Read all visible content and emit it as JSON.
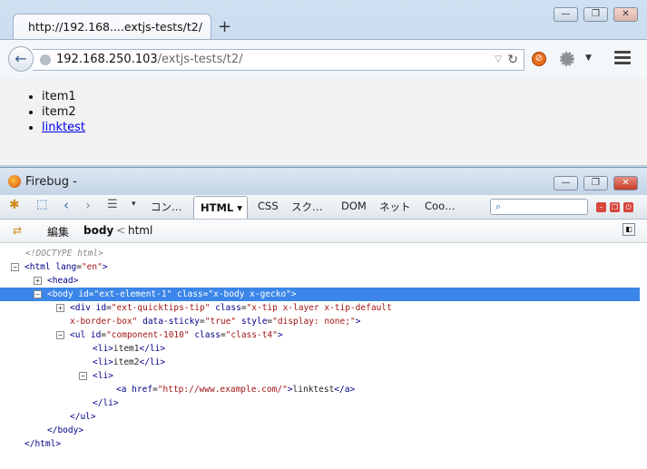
{
  "browser": {
    "tab_title": "http://192.168....extjs-tests/t2/",
    "new_tab": "+",
    "url_host": "192.168.250.103",
    "url_path": "/extjs-tests/t2/",
    "window_controls": {
      "minimize": "—",
      "maximize": "❐",
      "close": "✕"
    }
  },
  "page": {
    "items": [
      "item1",
      "item2"
    ],
    "link_text": "linktest"
  },
  "firebug": {
    "title": "Firebug -",
    "toolbar": {
      "console": "コン…",
      "html": "HTML ▾",
      "css": "CSS",
      "script": "スク…",
      "dom": "DOM",
      "net": "ネット",
      "cookies": "Coo…"
    },
    "breadcrumb": {
      "edit": "編集",
      "body": "body",
      "sep": "<",
      "html": "html"
    },
    "code": {
      "doctype": "<!DOCTYPE html>",
      "l1": {
        "open": "<html ",
        "a1": "lang",
        "v1": "\"en\"",
        "close": ">"
      },
      "l2": "<head>",
      "l3": {
        "open": "<body ",
        "a1": "id",
        "v1": "\"ext-element-1\"",
        "a2": "class",
        "v2": "\"x-body x-gecko\"",
        "close": ">"
      },
      "l4": {
        "open": "<div ",
        "a1": "id",
        "v1": "\"ext-quicktips-tip\"",
        "a2": "class",
        "v2": "\"x-tip x-layer x-tip-default"
      },
      "l5": {
        "cont": "x-border-box\"",
        "a1": "data-sticky",
        "v1": "\"true\"",
        "a2": "style",
        "v2": "\"display: none;\"",
        "close": ">"
      },
      "l6": {
        "open": "<ul ",
        "a1": "id",
        "v1": "\"component-1010\"",
        "a2": "class",
        "v2": "\"class-t4\"",
        "close": ">"
      },
      "l7": {
        "open": "<li>",
        "text": "item1",
        "close": "</li>"
      },
      "l8": {
        "open": "<li>",
        "text": "item2",
        "close": "</li>"
      },
      "l9": "<li>",
      "l10": {
        "open": "<a ",
        "a1": "href",
        "v1": "\"http://www.example.com/\"",
        "close": ">",
        "text": "linktest",
        "end": "</a>"
      },
      "l11": "</li>",
      "l12": "</ul>",
      "l13": "</body>",
      "l14": "</html>"
    }
  }
}
